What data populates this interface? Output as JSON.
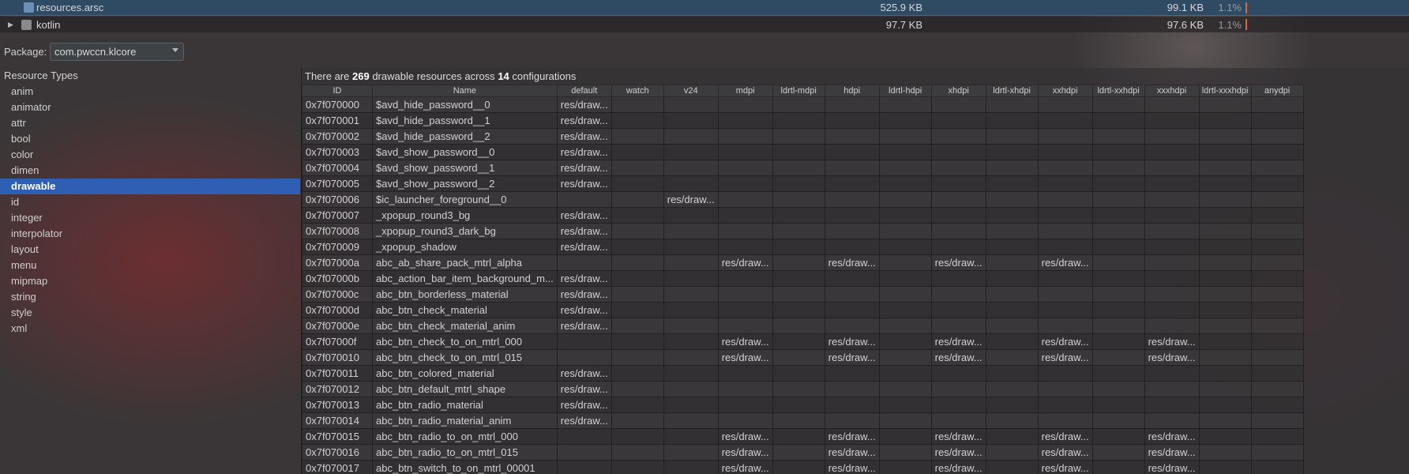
{
  "file_rows": [
    {
      "name": "resources.arsc",
      "size": "525.9 KB",
      "download": "99.1 KB",
      "percent": "1.1%",
      "expanded": null,
      "icon": "file-icon"
    },
    {
      "name": "kotlin",
      "size": "97.7 KB",
      "download": "97.6 KB",
      "percent": "1.1%",
      "expanded": false,
      "icon": "folder-icon"
    }
  ],
  "package": {
    "label": "Package:",
    "value": "com.pwccn.klcore"
  },
  "types": {
    "header": "Resource Types",
    "selected": "drawable",
    "items": [
      "anim",
      "animator",
      "attr",
      "bool",
      "color",
      "dimen",
      "drawable",
      "id",
      "integer",
      "interpolator",
      "layout",
      "menu",
      "mipmap",
      "string",
      "style",
      "xml"
    ]
  },
  "summary": {
    "prefix": "There are",
    "count": "269",
    "middle": "drawable resources across",
    "configs": "14",
    "suffix": "configurations"
  },
  "table": {
    "columns": [
      "ID",
      "Name",
      "default",
      "watch",
      "v24",
      "mdpi",
      "ldrtl-mdpi",
      "hdpi",
      "ldrtl-hdpi",
      "xhdpi",
      "ldrtl-xhdpi",
      "xxhdpi",
      "ldrtl-xxhdpi",
      "xxxhdpi",
      "ldrtl-xxxhdpi",
      "anydpi"
    ],
    "cell_text": "res/draw...",
    "rows": [
      {
        "id": "0x7f070000",
        "name": "$avd_hide_password__0",
        "cols": [
          "default"
        ]
      },
      {
        "id": "0x7f070001",
        "name": "$avd_hide_password__1",
        "cols": [
          "default"
        ]
      },
      {
        "id": "0x7f070002",
        "name": "$avd_hide_password__2",
        "cols": [
          "default"
        ]
      },
      {
        "id": "0x7f070003",
        "name": "$avd_show_password__0",
        "cols": [
          "default"
        ]
      },
      {
        "id": "0x7f070004",
        "name": "$avd_show_password__1",
        "cols": [
          "default"
        ]
      },
      {
        "id": "0x7f070005",
        "name": "$avd_show_password__2",
        "cols": [
          "default"
        ]
      },
      {
        "id": "0x7f070006",
        "name": "$ic_launcher_foreground__0",
        "cols": [
          "v24"
        ]
      },
      {
        "id": "0x7f070007",
        "name": "_xpopup_round3_bg",
        "cols": [
          "default"
        ]
      },
      {
        "id": "0x7f070008",
        "name": "_xpopup_round3_dark_bg",
        "cols": [
          "default"
        ]
      },
      {
        "id": "0x7f070009",
        "name": "_xpopup_shadow",
        "cols": [
          "default"
        ]
      },
      {
        "id": "0x7f07000a",
        "name": "abc_ab_share_pack_mtrl_alpha",
        "cols": [
          "mdpi",
          "hdpi",
          "xhdpi",
          "xxhdpi"
        ]
      },
      {
        "id": "0x7f07000b",
        "name": "abc_action_bar_item_background_m...",
        "cols": [
          "default"
        ]
      },
      {
        "id": "0x7f07000c",
        "name": "abc_btn_borderless_material",
        "cols": [
          "default"
        ]
      },
      {
        "id": "0x7f07000d",
        "name": "abc_btn_check_material",
        "cols": [
          "default"
        ]
      },
      {
        "id": "0x7f07000e",
        "name": "abc_btn_check_material_anim",
        "cols": [
          "default"
        ]
      },
      {
        "id": "0x7f07000f",
        "name": "abc_btn_check_to_on_mtrl_000",
        "cols": [
          "mdpi",
          "hdpi",
          "xhdpi",
          "xxhdpi",
          "xxxhdpi"
        ]
      },
      {
        "id": "0x7f070010",
        "name": "abc_btn_check_to_on_mtrl_015",
        "cols": [
          "mdpi",
          "hdpi",
          "xhdpi",
          "xxhdpi",
          "xxxhdpi"
        ]
      },
      {
        "id": "0x7f070011",
        "name": "abc_btn_colored_material",
        "cols": [
          "default"
        ]
      },
      {
        "id": "0x7f070012",
        "name": "abc_btn_default_mtrl_shape",
        "cols": [
          "default"
        ]
      },
      {
        "id": "0x7f070013",
        "name": "abc_btn_radio_material",
        "cols": [
          "default"
        ]
      },
      {
        "id": "0x7f070014",
        "name": "abc_btn_radio_material_anim",
        "cols": [
          "default"
        ]
      },
      {
        "id": "0x7f070015",
        "name": "abc_btn_radio_to_on_mtrl_000",
        "cols": [
          "mdpi",
          "hdpi",
          "xhdpi",
          "xxhdpi",
          "xxxhdpi"
        ]
      },
      {
        "id": "0x7f070016",
        "name": "abc_btn_radio_to_on_mtrl_015",
        "cols": [
          "mdpi",
          "hdpi",
          "xhdpi",
          "xxhdpi",
          "xxxhdpi"
        ]
      },
      {
        "id": "0x7f070017",
        "name": "abc_btn_switch_to_on_mtrl_00001",
        "cols": [
          "mdpi",
          "hdpi",
          "xhdpi",
          "xxhdpi",
          "xxxhdpi"
        ]
      }
    ]
  },
  "colors": {
    "selection": "#2f5fb3",
    "tree_selection": "#2f4a63",
    "bar": "#e0663a"
  }
}
